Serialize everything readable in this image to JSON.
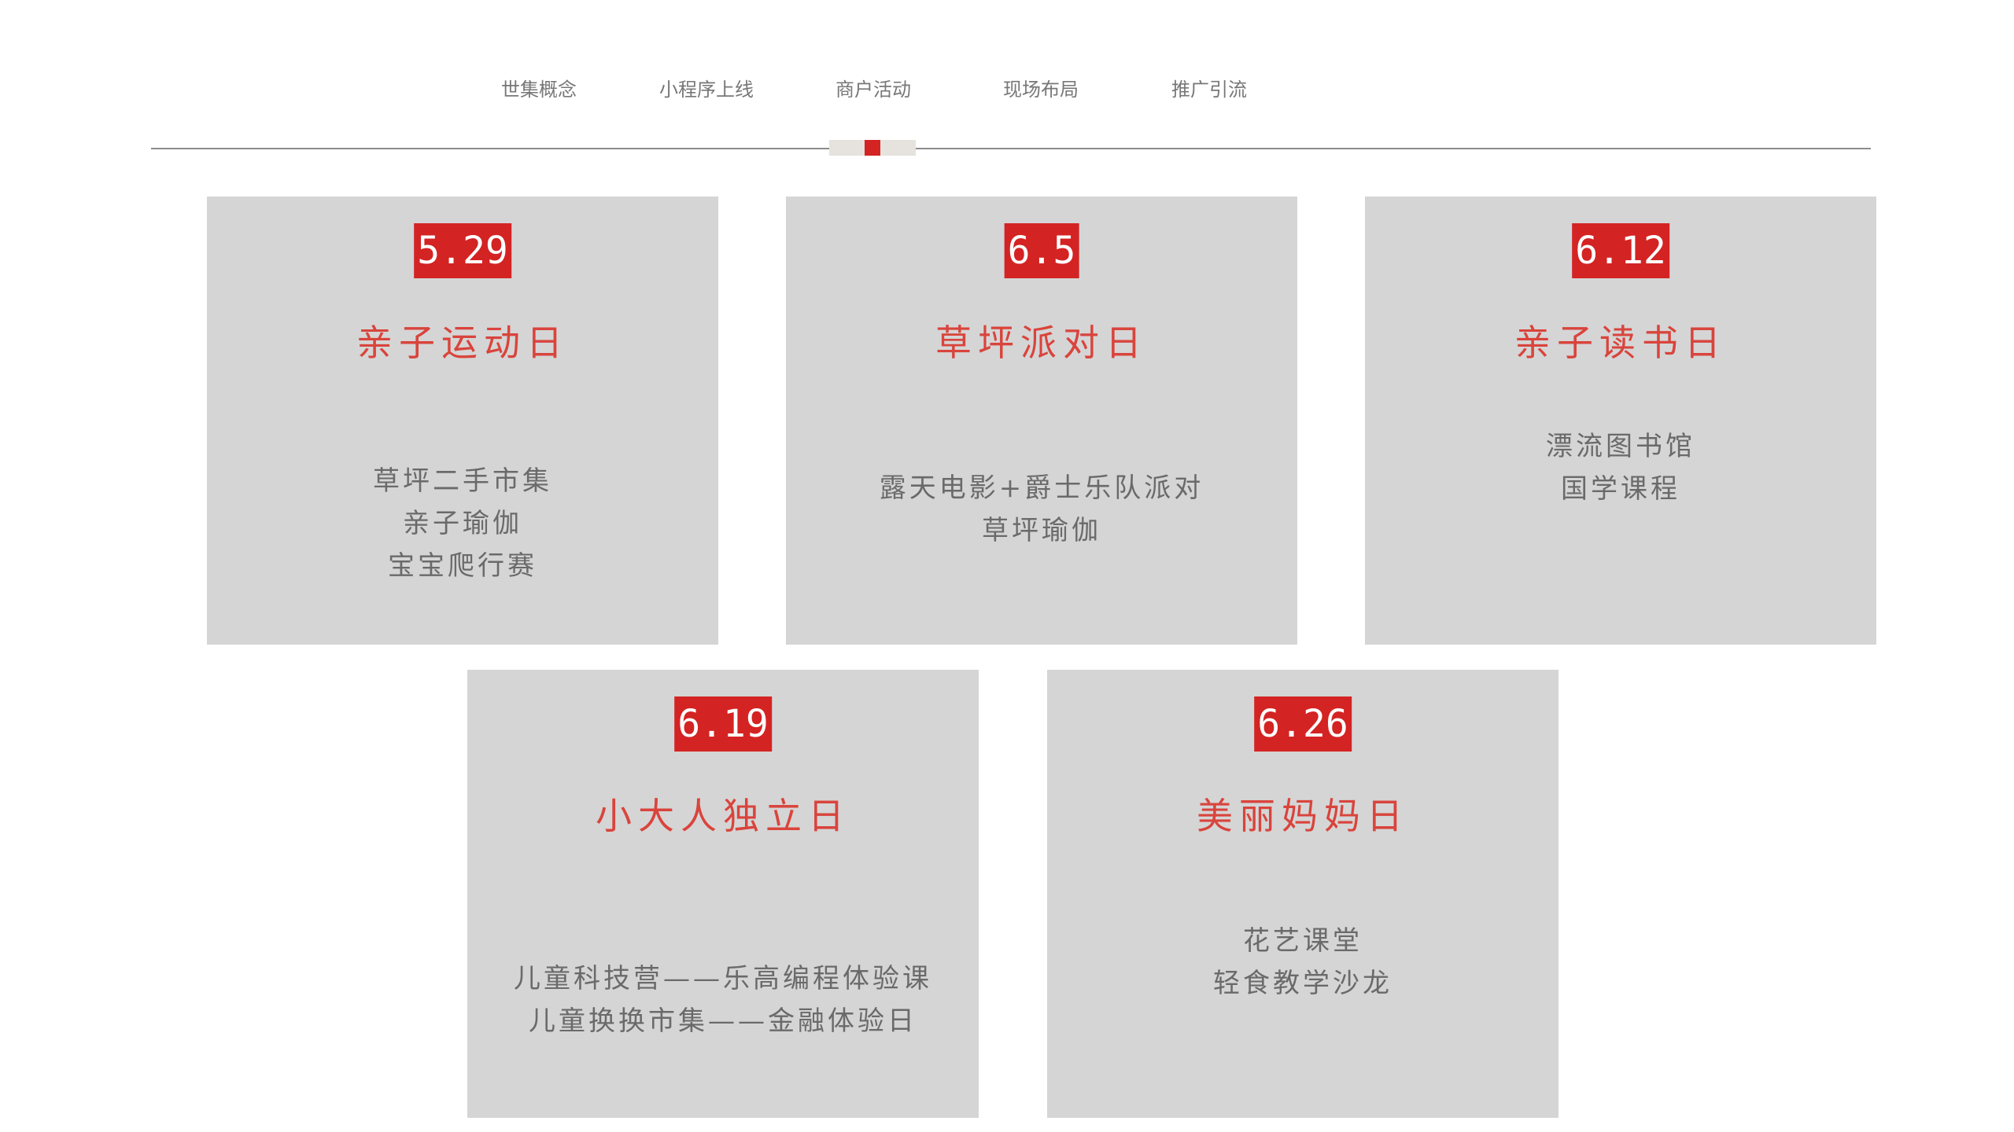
{
  "nav": {
    "items": [
      {
        "label": "世集概念"
      },
      {
        "label": "小程序上线"
      },
      {
        "label": "商户活动"
      },
      {
        "label": "现场布局"
      },
      {
        "label": "推广引流"
      }
    ],
    "active_index": 2
  },
  "colors": {
    "accent": "#d42323",
    "title_red": "#d9443c",
    "card_bg": "#d5d5d5",
    "text_gray": "#6a6a6a",
    "nav_text": "#777777"
  },
  "cards": [
    {
      "date": "5.29",
      "title": "亲子运动日",
      "items": [
        "草坪二手市集",
        "亲子瑜伽",
        "宝宝爬行赛"
      ]
    },
    {
      "date": "6.5",
      "title": "草坪派对日",
      "items": [
        "露天电影+爵士乐队派对",
        "草坪瑜伽"
      ]
    },
    {
      "date": "6.12",
      "title": "亲子读书日",
      "items": [
        "漂流图书馆",
        "国学课程"
      ]
    },
    {
      "date": "6.19",
      "title": "小大人独立日",
      "items": [
        "儿童科技营——乐高编程体验课",
        "儿童换换市集——金融体验日"
      ]
    },
    {
      "date": "6.26",
      "title": "美丽妈妈日",
      "items": [
        "花艺课堂",
        "轻食教学沙龙"
      ]
    }
  ]
}
